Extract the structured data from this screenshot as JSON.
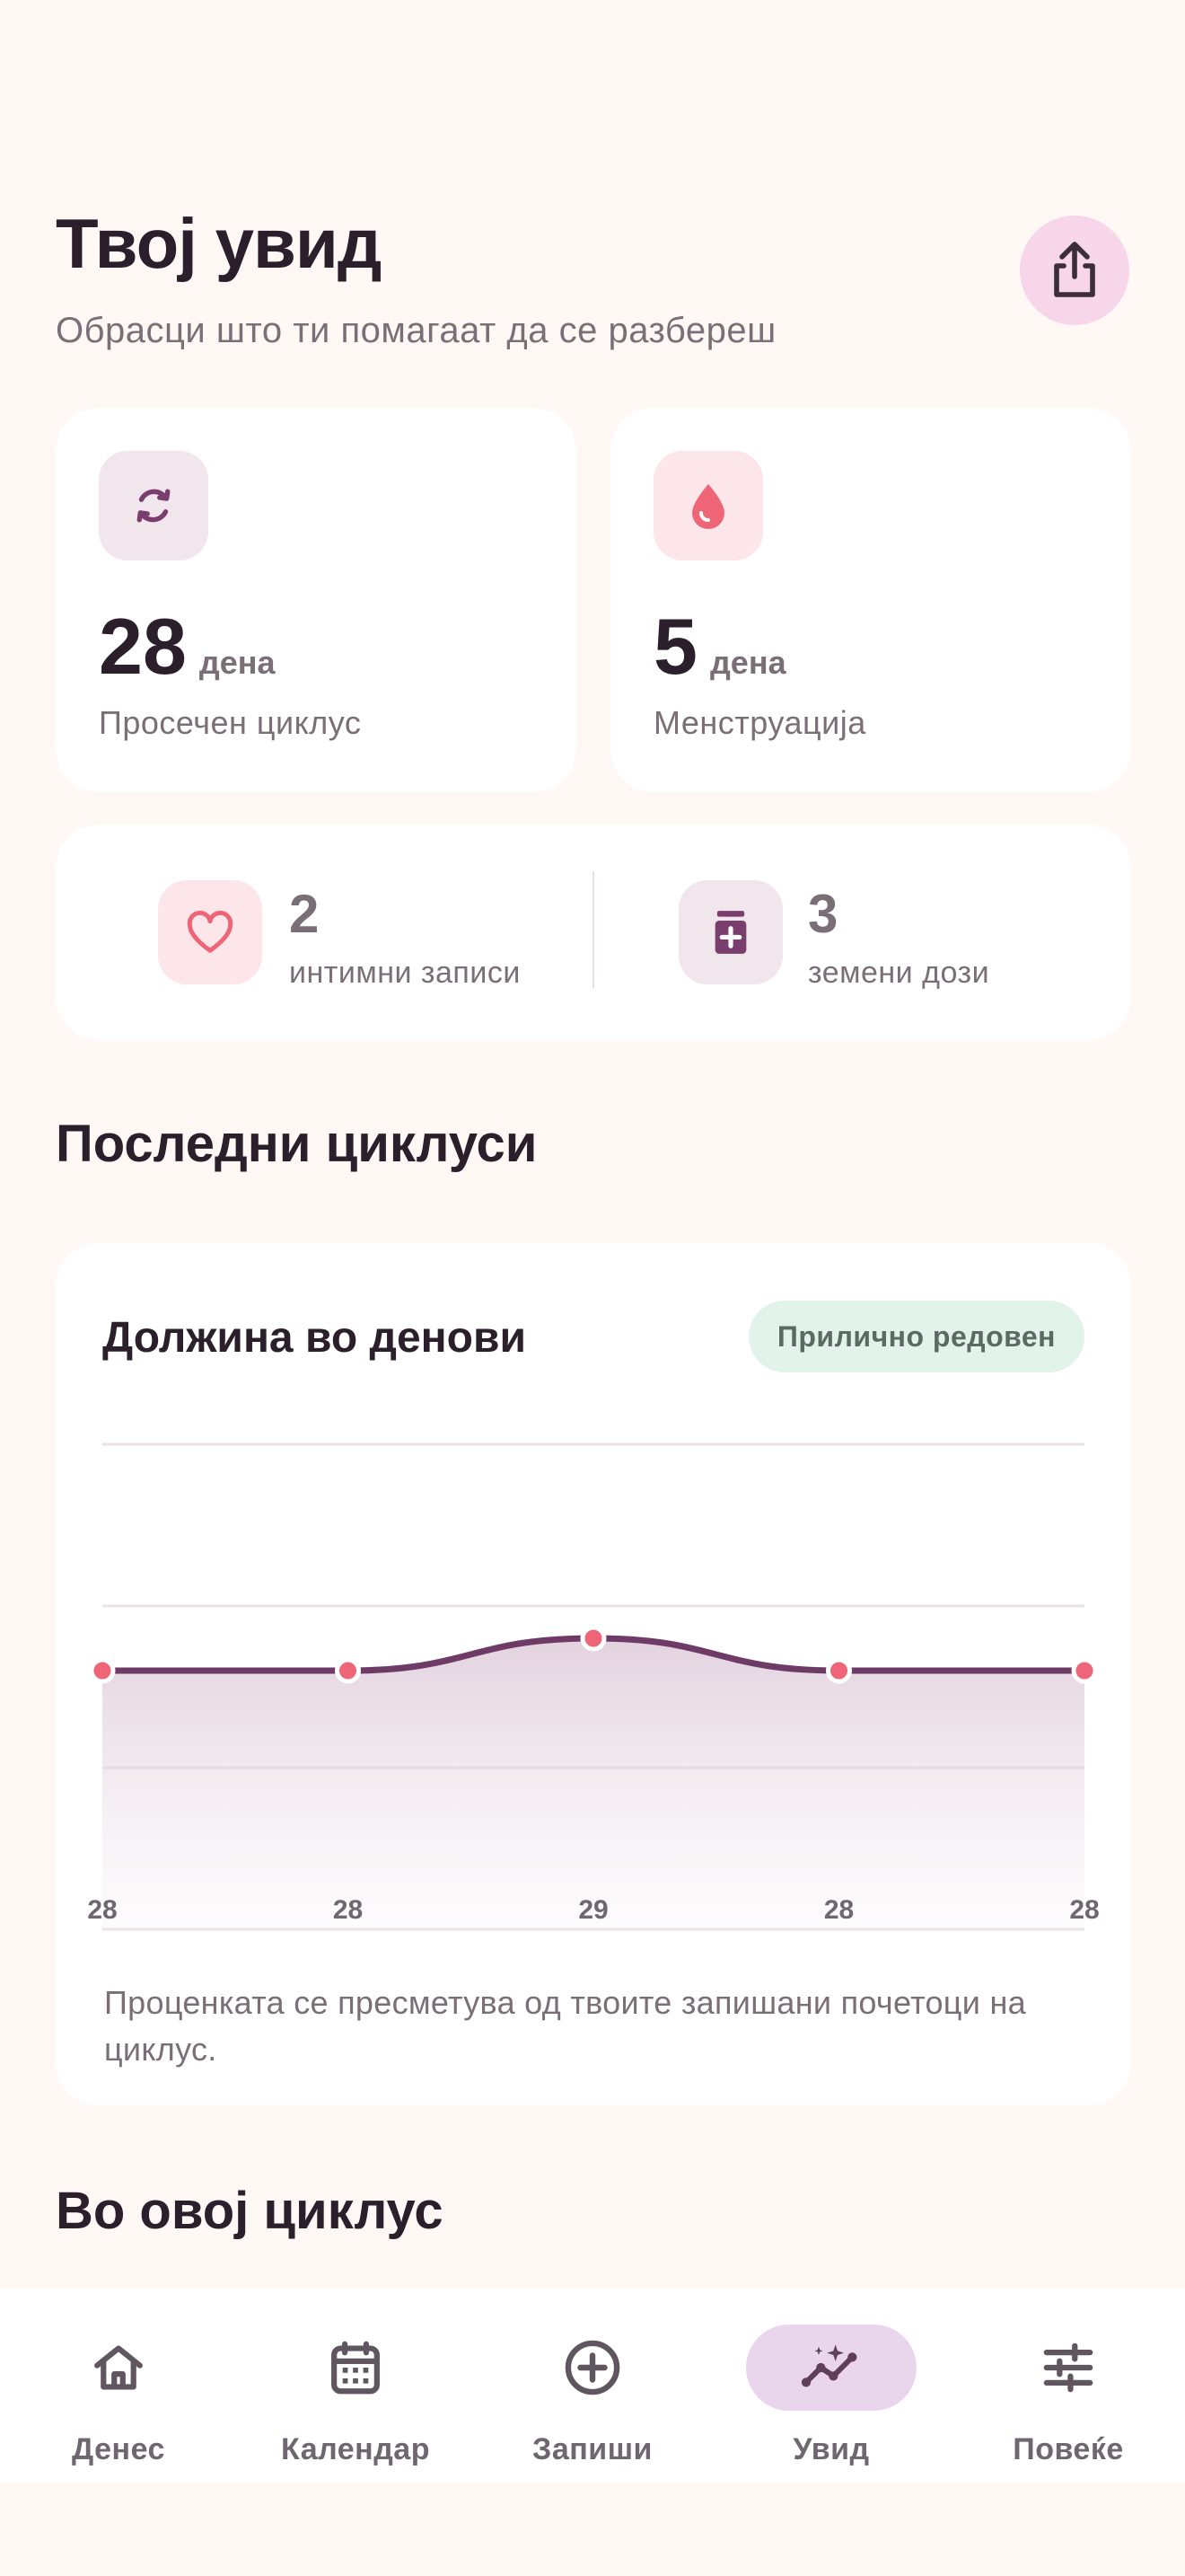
{
  "header": {
    "title": "Твој увид",
    "subtitle": "Обрасци што ти помагаат да се разбереш"
  },
  "stats": [
    {
      "value": "28",
      "unit": "дена",
      "label": "Просечен циклус",
      "icon": "cycle-icon"
    },
    {
      "value": "5",
      "unit": "дена",
      "label": "Менструација",
      "icon": "drop-icon"
    }
  ],
  "mini_stats": [
    {
      "value": "2",
      "label": "интимни записи",
      "icon": "heart-icon"
    },
    {
      "value": "3",
      "label": "земени дози",
      "icon": "pill-icon"
    }
  ],
  "recent": {
    "section_title": "Последни циклуси",
    "chart_title": "Должина во денови",
    "badge": "Прилично редовен",
    "note": "Проценката се пресметува од твоите запишани почетоци на циклус."
  },
  "chart_data": {
    "type": "line",
    "x": [
      1,
      2,
      3,
      4,
      5
    ],
    "values": [
      28,
      28,
      29,
      28,
      28
    ],
    "tick_labels": [
      "28",
      "28",
      "29",
      "28",
      "28"
    ],
    "ylim": [
      20,
      35
    ],
    "grid": true,
    "line_color": "#6E3A66",
    "point_color": "#EE6577",
    "title": "Должина во денови"
  },
  "next_section": {
    "title": "Во овој циклус"
  },
  "tabs": [
    {
      "label": "Денес",
      "icon": "home-icon",
      "active": false
    },
    {
      "label": "Календар",
      "icon": "calendar-icon",
      "active": false
    },
    {
      "label": "Запиши",
      "icon": "plus-circle-icon",
      "active": false
    },
    {
      "label": "Увид",
      "icon": "insights-icon",
      "active": true
    },
    {
      "label": "Повеќе",
      "icon": "sliders-icon",
      "active": false
    }
  ],
  "colors": {
    "background": "#FFF8F4",
    "accent": "#6E3A66",
    "pink": "#EE6577",
    "badge_bg": "#E1F3EA"
  }
}
